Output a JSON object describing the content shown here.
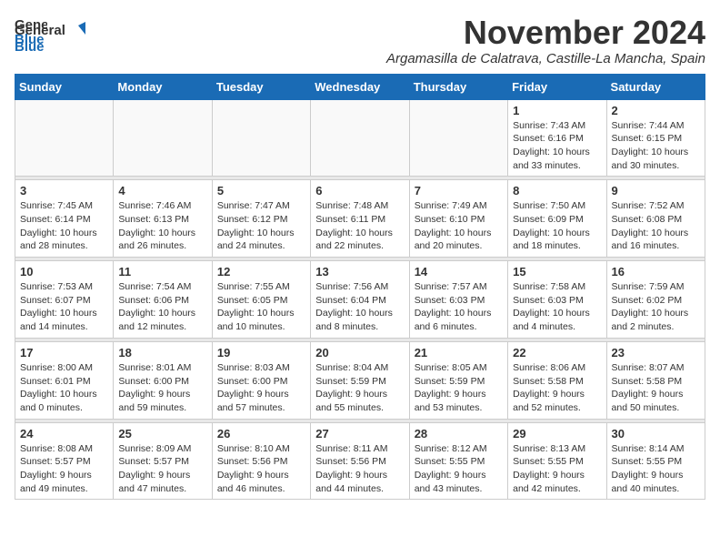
{
  "header": {
    "logo_general": "General",
    "logo_blue": "Blue",
    "month": "November 2024",
    "location": "Argamasilla de Calatrava, Castille-La Mancha, Spain"
  },
  "weekdays": [
    "Sunday",
    "Monday",
    "Tuesday",
    "Wednesday",
    "Thursday",
    "Friday",
    "Saturday"
  ],
  "weeks": [
    [
      {
        "day": "",
        "info": ""
      },
      {
        "day": "",
        "info": ""
      },
      {
        "day": "",
        "info": ""
      },
      {
        "day": "",
        "info": ""
      },
      {
        "day": "",
        "info": ""
      },
      {
        "day": "1",
        "info": "Sunrise: 7:43 AM\nSunset: 6:16 PM\nDaylight: 10 hours\nand 33 minutes."
      },
      {
        "day": "2",
        "info": "Sunrise: 7:44 AM\nSunset: 6:15 PM\nDaylight: 10 hours\nand 30 minutes."
      }
    ],
    [
      {
        "day": "3",
        "info": "Sunrise: 7:45 AM\nSunset: 6:14 PM\nDaylight: 10 hours\nand 28 minutes."
      },
      {
        "day": "4",
        "info": "Sunrise: 7:46 AM\nSunset: 6:13 PM\nDaylight: 10 hours\nand 26 minutes."
      },
      {
        "day": "5",
        "info": "Sunrise: 7:47 AM\nSunset: 6:12 PM\nDaylight: 10 hours\nand 24 minutes."
      },
      {
        "day": "6",
        "info": "Sunrise: 7:48 AM\nSunset: 6:11 PM\nDaylight: 10 hours\nand 22 minutes."
      },
      {
        "day": "7",
        "info": "Sunrise: 7:49 AM\nSunset: 6:10 PM\nDaylight: 10 hours\nand 20 minutes."
      },
      {
        "day": "8",
        "info": "Sunrise: 7:50 AM\nSunset: 6:09 PM\nDaylight: 10 hours\nand 18 minutes."
      },
      {
        "day": "9",
        "info": "Sunrise: 7:52 AM\nSunset: 6:08 PM\nDaylight: 10 hours\nand 16 minutes."
      }
    ],
    [
      {
        "day": "10",
        "info": "Sunrise: 7:53 AM\nSunset: 6:07 PM\nDaylight: 10 hours\nand 14 minutes."
      },
      {
        "day": "11",
        "info": "Sunrise: 7:54 AM\nSunset: 6:06 PM\nDaylight: 10 hours\nand 12 minutes."
      },
      {
        "day": "12",
        "info": "Sunrise: 7:55 AM\nSunset: 6:05 PM\nDaylight: 10 hours\nand 10 minutes."
      },
      {
        "day": "13",
        "info": "Sunrise: 7:56 AM\nSunset: 6:04 PM\nDaylight: 10 hours\nand 8 minutes."
      },
      {
        "day": "14",
        "info": "Sunrise: 7:57 AM\nSunset: 6:03 PM\nDaylight: 10 hours\nand 6 minutes."
      },
      {
        "day": "15",
        "info": "Sunrise: 7:58 AM\nSunset: 6:03 PM\nDaylight: 10 hours\nand 4 minutes."
      },
      {
        "day": "16",
        "info": "Sunrise: 7:59 AM\nSunset: 6:02 PM\nDaylight: 10 hours\nand 2 minutes."
      }
    ],
    [
      {
        "day": "17",
        "info": "Sunrise: 8:00 AM\nSunset: 6:01 PM\nDaylight: 10 hours\nand 0 minutes."
      },
      {
        "day": "18",
        "info": "Sunrise: 8:01 AM\nSunset: 6:00 PM\nDaylight: 9 hours\nand 59 minutes."
      },
      {
        "day": "19",
        "info": "Sunrise: 8:03 AM\nSunset: 6:00 PM\nDaylight: 9 hours\nand 57 minutes."
      },
      {
        "day": "20",
        "info": "Sunrise: 8:04 AM\nSunset: 5:59 PM\nDaylight: 9 hours\nand 55 minutes."
      },
      {
        "day": "21",
        "info": "Sunrise: 8:05 AM\nSunset: 5:59 PM\nDaylight: 9 hours\nand 53 minutes."
      },
      {
        "day": "22",
        "info": "Sunrise: 8:06 AM\nSunset: 5:58 PM\nDaylight: 9 hours\nand 52 minutes."
      },
      {
        "day": "23",
        "info": "Sunrise: 8:07 AM\nSunset: 5:58 PM\nDaylight: 9 hours\nand 50 minutes."
      }
    ],
    [
      {
        "day": "24",
        "info": "Sunrise: 8:08 AM\nSunset: 5:57 PM\nDaylight: 9 hours\nand 49 minutes."
      },
      {
        "day": "25",
        "info": "Sunrise: 8:09 AM\nSunset: 5:57 PM\nDaylight: 9 hours\nand 47 minutes."
      },
      {
        "day": "26",
        "info": "Sunrise: 8:10 AM\nSunset: 5:56 PM\nDaylight: 9 hours\nand 46 minutes."
      },
      {
        "day": "27",
        "info": "Sunrise: 8:11 AM\nSunset: 5:56 PM\nDaylight: 9 hours\nand 44 minutes."
      },
      {
        "day": "28",
        "info": "Sunrise: 8:12 AM\nSunset: 5:55 PM\nDaylight: 9 hours\nand 43 minutes."
      },
      {
        "day": "29",
        "info": "Sunrise: 8:13 AM\nSunset: 5:55 PM\nDaylight: 9 hours\nand 42 minutes."
      },
      {
        "day": "30",
        "info": "Sunrise: 8:14 AM\nSunset: 5:55 PM\nDaylight: 9 hours\nand 40 minutes."
      }
    ]
  ]
}
